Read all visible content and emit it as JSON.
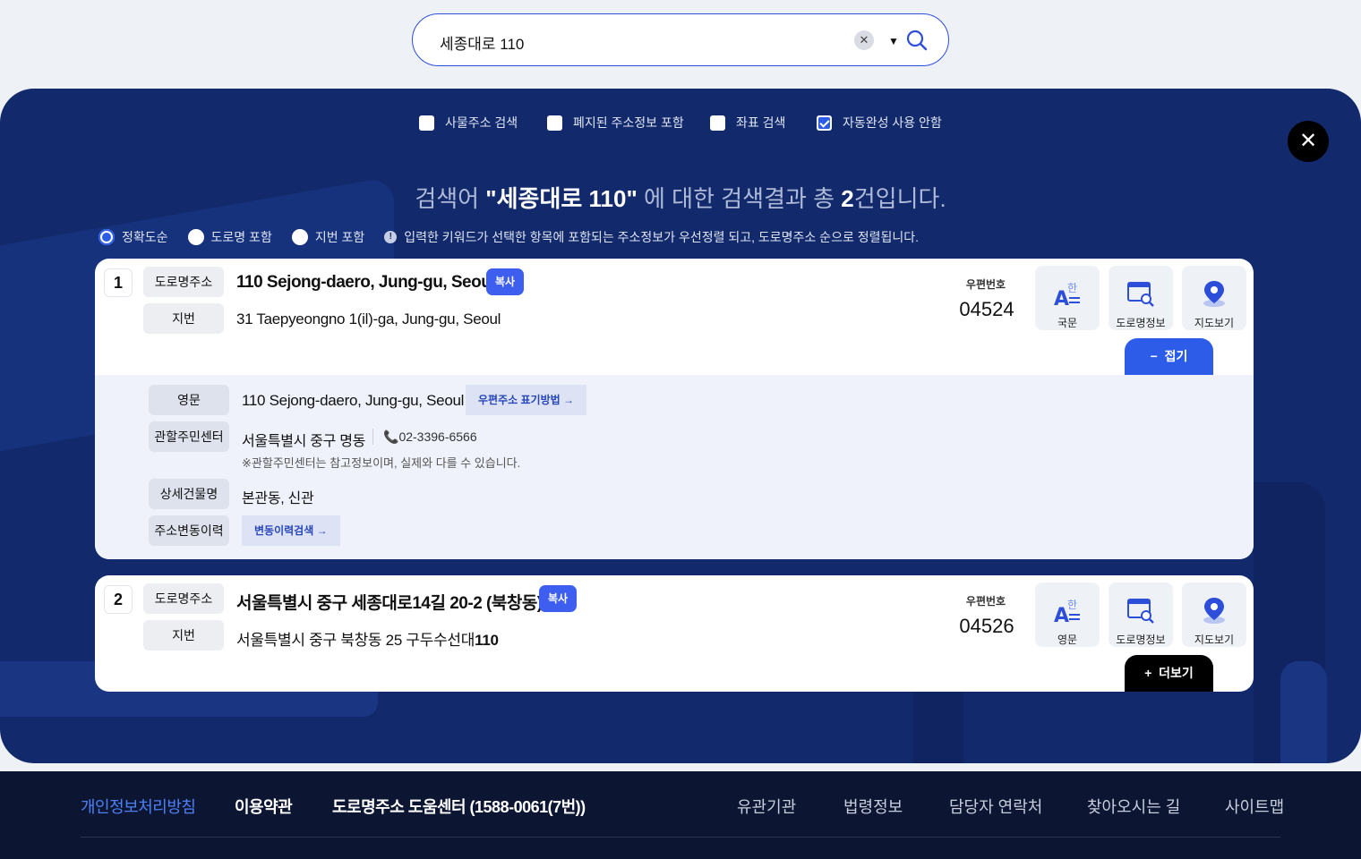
{
  "search": {
    "query": "세종대로 110"
  },
  "options": [
    {
      "label": "사물주소 검색",
      "checked": false
    },
    {
      "label": "폐지된 주소정보 포함",
      "checked": false
    },
    {
      "label": "좌표 검색",
      "checked": false
    },
    {
      "label": "자동완성 사용 안함",
      "checked": true
    }
  ],
  "summary": {
    "prefix": "검색어 ",
    "keyword": "\"세종대로 110\"",
    "middle": " 에 대한 검색결과 총 ",
    "count": "2",
    "suffix": "건입니다."
  },
  "sort": {
    "items": [
      "정확도순",
      "도로명 포함",
      "지번 포함"
    ],
    "selected": "정확도순",
    "note": "입력한 키워드가 선택한 항목에 포함되는 주소정보가 우선정렬 되고, 도로명주소 순으로 정렬됩니다."
  },
  "labels": {
    "road": "도로명주소",
    "jibun": "지번",
    "copy": "복사",
    "zip": "우편번호",
    "english": "영문",
    "korean": "국문",
    "road_info": "도로명정보",
    "map": "지도보기",
    "fold": "접기",
    "more": "더보기"
  },
  "results": [
    {
      "num": "1",
      "road": "110 Sejong-daero, Jung-gu, Seoul",
      "jibun": "31 Taepyeongno 1(il)-ga, Jung-gu, Seoul",
      "zip": "04524",
      "detail": {
        "english_label": "영문",
        "english_value": "110 Sejong-daero, Jung-gu, Seoul",
        "english_link": "우편주소 표기방법 →",
        "center_label": "관할주민센터",
        "center_value": "서울특별시 중구 명동",
        "center_phone": "02-3396-6566",
        "center_note": "※관할주민센터는 참고정보이며, 실제와 다를 수 있습니다.",
        "building_label": "상세건물명",
        "building_value": "본관동, 신관",
        "history_label": "주소변동이력",
        "history_link": "변동이력검색 →"
      }
    },
    {
      "num": "2",
      "road": "서울특별시 중구 세종대로14길 20-2 (북창동)",
      "jibun_prefix": "서울특별시 중구 북창동 25 구두수선대",
      "jibun_bold": "110",
      "zip": "04526"
    }
  ],
  "footer": {
    "left": [
      "개인정보처리방침",
      "이용약관",
      "도로명주소 도움센터 (1588-0061(7번))"
    ],
    "right": [
      "유관기관",
      "법령정보",
      "담당자 연락처",
      "찾아오시는 길",
      "사이트맵"
    ]
  }
}
